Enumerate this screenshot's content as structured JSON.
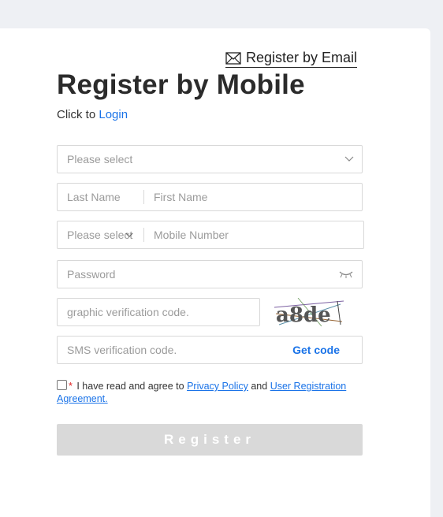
{
  "header": {
    "switch_label": "Register by Email",
    "title": "Register by Mobile",
    "login_prefix": "Click to",
    "login_link": "Login"
  },
  "form": {
    "country_placeholder": "Please select",
    "last_name_placeholder": "Last Name",
    "first_name_placeholder": "First Name",
    "code_placeholder": "Please select",
    "mobile_placeholder": "Mobile Number",
    "password_placeholder": "Password",
    "graphic_code_placeholder": "graphic verification code.",
    "captcha_text": "a8de",
    "sms_placeholder": "SMS verification code.",
    "get_code_label": "Get code"
  },
  "agreement": {
    "required_mark": "*",
    "text_before": "I have read and agree to",
    "privacy_link": "Privacy Policy",
    "and_text": "and",
    "terms_link": "User Registration Agreement."
  },
  "register_label": "Register",
  "colors": {
    "link": "#1a73e8",
    "button_disabled": "#d9d9d9",
    "required": "#e02020",
    "page_bg": "#eef0f4"
  },
  "icons": {
    "switch": "mail-icon",
    "select": "chevron-down-icon",
    "password": "eye-closed-icon"
  }
}
